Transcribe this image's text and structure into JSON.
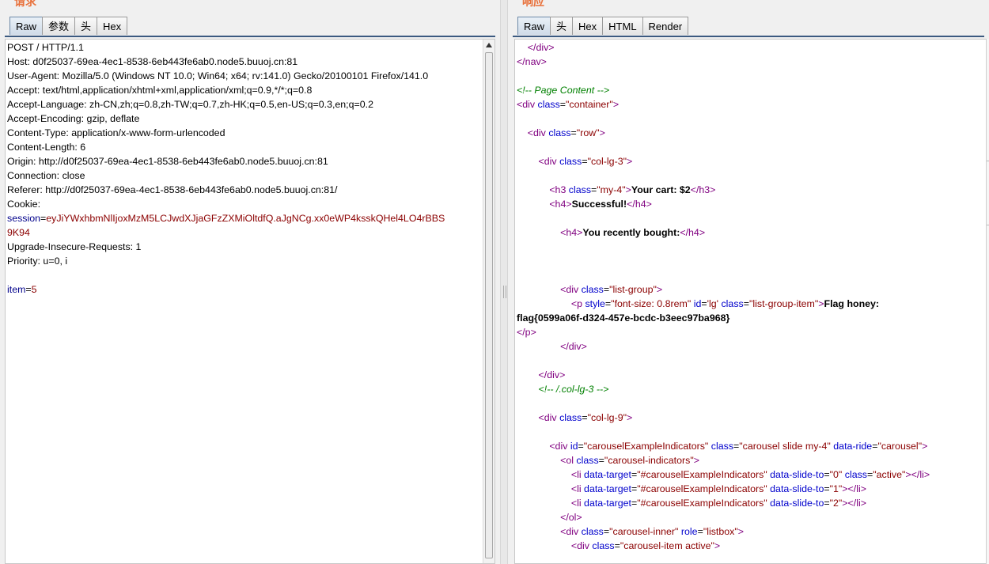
{
  "request": {
    "title": "请求",
    "tabs": [
      "Raw",
      "参数",
      "头",
      "Hex"
    ],
    "active_tab": "Raw",
    "lines": [
      "POST / HTTP/1.1",
      "Host: d0f25037-69ea-4ec1-8538-6eb443fe6ab0.node5.buuoj.cn:81",
      "User-Agent: Mozilla/5.0 (Windows NT 10.0; Win64; x64; rv:141.0) Gecko/20100101 Firefox/141.0",
      "Accept: text/html,application/xhtml+xml,application/xml;q=0.9,*/*;q=0.8",
      "Accept-Language: zh-CN,zh;q=0.8,zh-TW;q=0.7,zh-HK;q=0.5,en-US;q=0.3,en;q=0.2",
      "Accept-Encoding: gzip, deflate",
      "Content-Type: application/x-www-form-urlencoded",
      "Content-Length: 6",
      "Origin: http://d0f25037-69ea-4ec1-8538-6eb443fe6ab0.node5.buuoj.cn:81",
      "Connection: close",
      "Referer: http://d0f25037-69ea-4ec1-8538-6eb443fe6ab0.node5.buuoj.cn:81/",
      "Cookie:"
    ],
    "cookie_key": "session",
    "cookie_value_1": "eyJiYWxhbmNlIjoxMzM5LCJwdXJjaGFzZXMiOltdfQ.aJgNCg.xx0eWP4ksskQHel4LO4rBBS",
    "cookie_value_2": "9K94",
    "lines_after": [
      "Upgrade-Insecure-Requests: 1",
      "Priority: u=0, i"
    ],
    "body_key": "item",
    "body_value": "5"
  },
  "response": {
    "title": "响应",
    "tabs": [
      "Raw",
      "头",
      "Hex",
      "HTML",
      "Render"
    ],
    "active_tab": "Raw",
    "code": {
      "l1": "</div>",
      "l2": "</nav>",
      "c1": "<!-- Page Content -->",
      "container": "container",
      "row": "row",
      "col3": "col-lg-3",
      "my4": "my-4",
      "cart": "Your cart: $2",
      "success": "Successful!",
      "bought": "You recently bought:",
      "listgroup": "list-group",
      "pstyle": "font-size: 0.8rem",
      "pid": "lg",
      "pclass": "list-group-item",
      "flag_label": "Flag honey:",
      "flag_value": "flag{0599a06f-d324-457e-bcdc-b3eec97ba968}",
      "c2": "<!-- /.col-lg-3 -->",
      "col9": "col-lg-9",
      "carousel_id": "carouselExampleIndicators",
      "carousel_class": "carousel slide my-4",
      "carousel_ride": "carousel",
      "indicators": "carousel-indicators",
      "target": "#carouselExampleIndicators",
      "active": "active",
      "inner": "carousel-inner",
      "role": "listbox",
      "item_active": "carousel-item active"
    }
  }
}
